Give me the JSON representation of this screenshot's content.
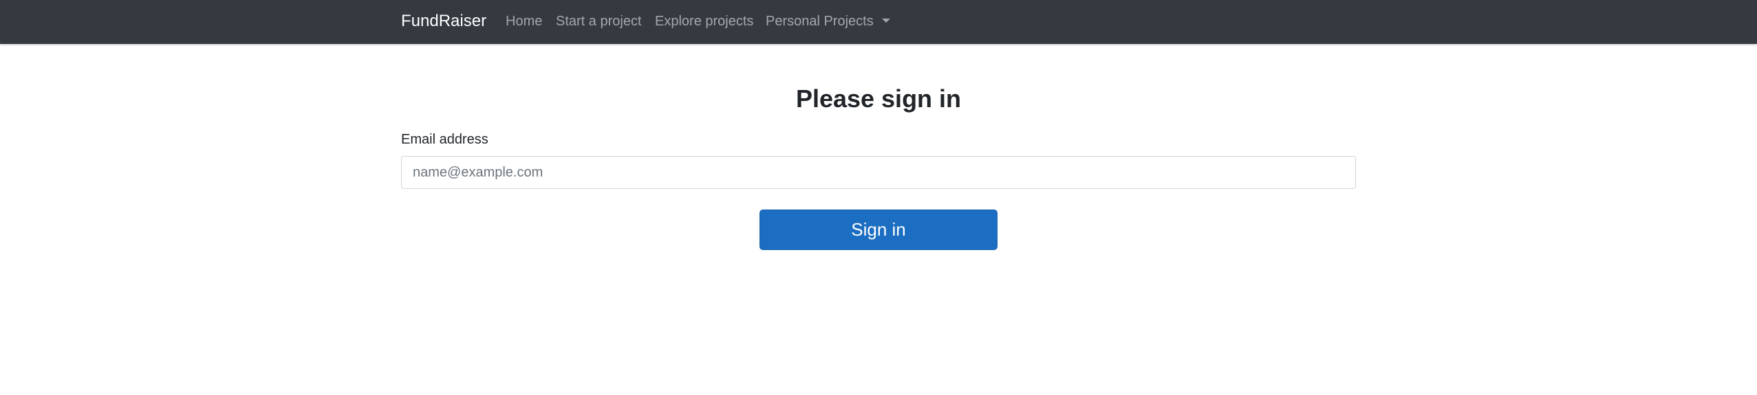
{
  "navbar": {
    "brand": "FundRaiser",
    "links": [
      "Home",
      "Start a project",
      "Explore projects"
    ],
    "dropdown_label": "Personal Projects"
  },
  "signin": {
    "title": "Please sign in",
    "email_label": "Email address",
    "email_value": "",
    "email_placeholder": "name@example.com",
    "submit_label": "Sign in"
  },
  "colors": {
    "navbar_bg": "#343a40",
    "primary_button": "#1b6ec2"
  }
}
